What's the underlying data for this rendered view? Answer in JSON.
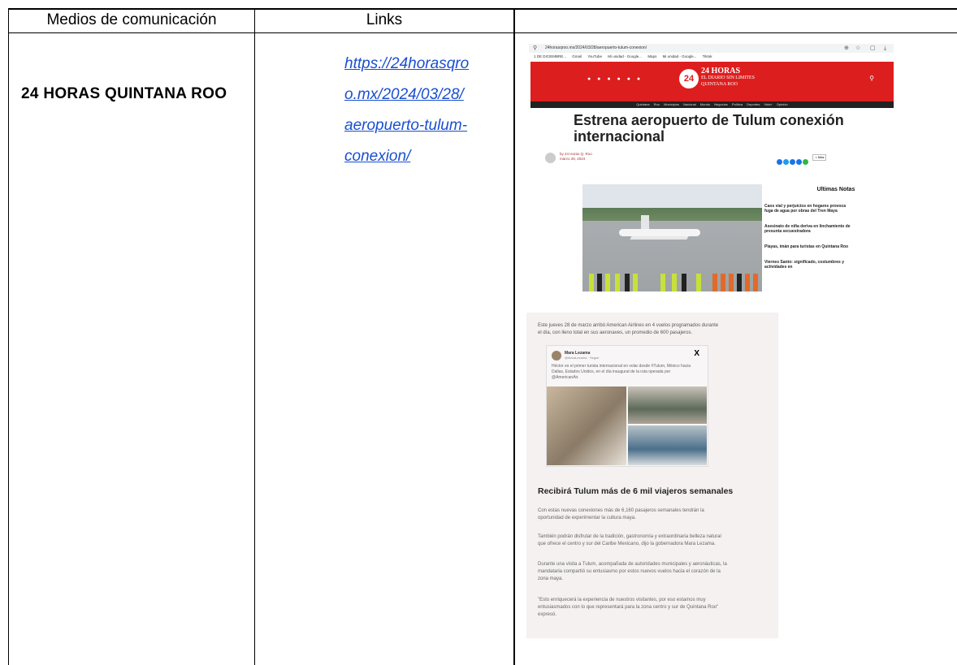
{
  "table": {
    "headers": [
      "Medios de comunicación",
      "Links",
      ""
    ],
    "row": {
      "outlet": "24 HORAS QUINTANA ROO",
      "link_lines": [
        "https://24horasqro",
        "o.mx/2024/03/28/",
        "aeropuerto-tulum-",
        "conexion/"
      ]
    }
  },
  "screenshot_web": {
    "address_bar": "24horasqroo.mx/2024/03/28/aeropuerto-tulum-conexion/",
    "bookmarks": [
      "1 DE DICIEMBRE...",
      "Gmail",
      "YouTube",
      "Mi unidad - Google...",
      "Maps",
      "Mi unidad - Google...",
      "Tiktok"
    ],
    "site_logo_number": "24",
    "site_name": "24 HORAS",
    "site_tagline_1": "EL DIARIO SIN LIMITES",
    "site_tagline_2": "QUINTANA ROO",
    "nav": "Quintana Roo   Municipios   Nacional   Mundo   Negocios   Política   Deportes   Vida+   Opinión",
    "headline": "Estrena aeropuerto de Tulum conexión internacional",
    "byline_author": "by 24 Horas Q. Roo",
    "byline_date": "marzo 28, 2024",
    "share_more": "< Más",
    "sidebar_title": "Ultimas Notas",
    "sidebar_items": [
      "Caos vial y perjuicios en hogares provoca fuga de agua por obras del Tren Maya",
      "Asesinato de niña deriva en linchamiento de presunta secuestradora",
      "Playas, imán para turistas en Quintana Roo",
      "Viernes Santo: significado, costumbres y actividades en"
    ]
  },
  "screenshot_print": {
    "intro_1": "Este jueves 28 de marzo arribó American Airlines en 4 vuelos programados durante",
    "intro_2": "el día, con lleno total en sus aeronaves, un promedio de 600 pasajeros.",
    "tweet_name": "Mara Lezama",
    "tweet_handle": "@MaraLezama · Seguir",
    "tweet_close": "X",
    "tweet_text": "Héctor es el primer turista internacional en volar desde #Tulum, México hacia Dallas, Estados Unidos, en el día inaugural de la ruta operada por @AmericanAir.",
    "title": "Recibirá Tulum más de 6 mil viajeros semanales",
    "para_1a": "Con estas nuevas conexiones más de 6,160 pasajeros semanales tendrán la",
    "para_1b": "oportunidad de experimentar la cultura maya.",
    "para_2a": "También podrán disfrutar de la tradición, gastronomía y extraordinaria belleza natural",
    "para_2b": "que ofrece el centro y sur del Caribe Mexicano, dijo la gobernadora Mara Lezama.",
    "para_3a": "Durante una visita a Tulum, acompañada de autoridades municipales y aeronáuticas, la",
    "para_3b": "mandataria compartió su entusiasmo por estos nuevos vuelos hacia el corazón de la",
    "para_3c": "zona maya.",
    "para_4a": "\"Esto enriquecerá la experiencia de nuestros visitantes, por eso estamos muy",
    "para_4b": "entusiasmados con lo que representará para la zona centro y sur de Quintana Roo\"",
    "para_4c": "expresó."
  }
}
